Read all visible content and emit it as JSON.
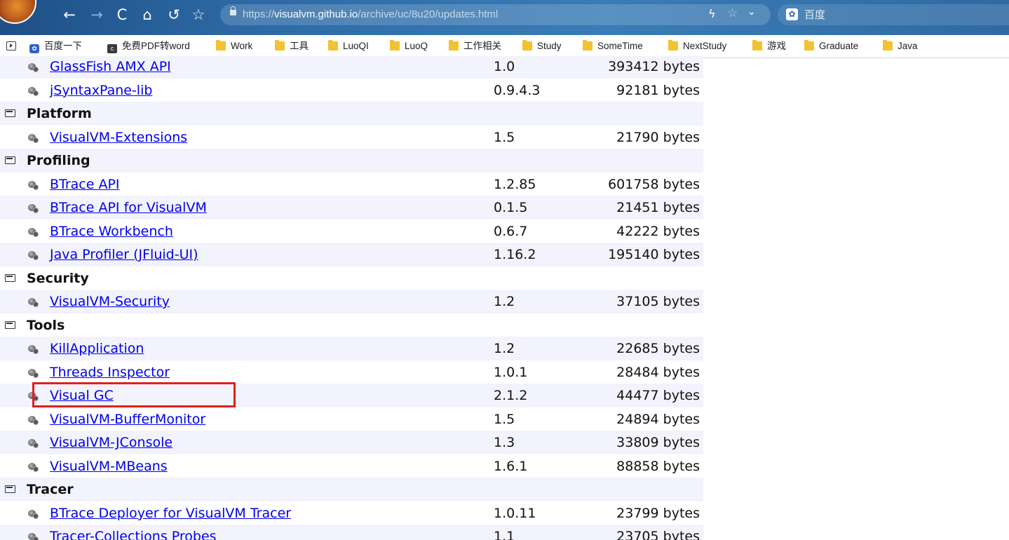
{
  "browser": {
    "nav_icons": {
      "back": "←",
      "forward": "→",
      "reload": "C",
      "home": "⌂",
      "undo": "↺",
      "star": "☆"
    },
    "url": {
      "scheme": "https://",
      "host": "visualvm.github.io",
      "path": "/archive/uc/8u20/updates.html"
    },
    "search_engine_label": "百度",
    "bookmarks": [
      {
        "label": "百度一下",
        "icon": "paw-icon"
      },
      {
        "label": "免费PDF转word",
        "icon": "c-icon"
      },
      {
        "label": "Work",
        "icon": "folder-icon"
      },
      {
        "label": "工具",
        "icon": "folder-icon"
      },
      {
        "label": "LuoQI",
        "icon": "folder-icon"
      },
      {
        "label": "LuoQ",
        "icon": "folder-icon"
      },
      {
        "label": "工作相关",
        "icon": "folder-icon"
      },
      {
        "label": "Study",
        "icon": "folder-icon"
      },
      {
        "label": "SomeTime",
        "icon": "folder-icon"
      },
      {
        "label": "NextStudy",
        "icon": "folder-icon"
      },
      {
        "label": "游戏",
        "icon": "folder-icon"
      },
      {
        "label": "Graduate",
        "icon": "folder-icon"
      },
      {
        "label": "Java",
        "icon": "folder-icon"
      }
    ]
  },
  "plugin_table": {
    "rows": [
      {
        "type": "plugin",
        "name": "GlassFish AMX API",
        "version": "1.0",
        "size": "393412 bytes"
      },
      {
        "type": "plugin",
        "name": "jSyntaxPane-lib",
        "version": "0.9.4.3",
        "size": "92181 bytes"
      },
      {
        "type": "category",
        "name": "Platform"
      },
      {
        "type": "plugin",
        "name": "VisualVM-Extensions",
        "version": "1.5",
        "size": "21790 bytes"
      },
      {
        "type": "category",
        "name": "Profiling"
      },
      {
        "type": "plugin",
        "name": "BTrace API",
        "version": "1.2.85",
        "size": "601758 bytes"
      },
      {
        "type": "plugin",
        "name": "BTrace API for VisualVM",
        "version": "0.1.5",
        "size": "21451 bytes"
      },
      {
        "type": "plugin",
        "name": "BTrace Workbench",
        "version": "0.6.7",
        "size": "42222 bytes"
      },
      {
        "type": "plugin",
        "name": "Java Profiler (JFluid-UI)",
        "version": "1.16.2",
        "size": "195140 bytes"
      },
      {
        "type": "category",
        "name": "Security"
      },
      {
        "type": "plugin",
        "name": "VisualVM-Security",
        "version": "1.2",
        "size": "37105 bytes"
      },
      {
        "type": "category",
        "name": "Tools"
      },
      {
        "type": "plugin",
        "name": "KillApplication",
        "version": "1.2",
        "size": "22685 bytes"
      },
      {
        "type": "plugin",
        "name": "Threads Inspector",
        "version": "1.0.1",
        "size": "28484 bytes"
      },
      {
        "type": "plugin",
        "name": "Visual GC",
        "version": "2.1.2",
        "size": "44477 bytes",
        "highlighted": true
      },
      {
        "type": "plugin",
        "name": "VisualVM-BufferMonitor",
        "version": "1.5",
        "size": "24894 bytes"
      },
      {
        "type": "plugin",
        "name": "VisualVM-JConsole",
        "version": "1.3",
        "size": "33809 bytes"
      },
      {
        "type": "plugin",
        "name": "VisualVM-MBeans",
        "version": "1.6.1",
        "size": "88858 bytes"
      },
      {
        "type": "category",
        "name": "Tracer"
      },
      {
        "type": "plugin",
        "name": "BTrace Deployer for VisualVM Tracer",
        "version": "1.0.11",
        "size": "23799 bytes"
      },
      {
        "type": "plugin",
        "name": "Tracer-Collections Probes",
        "version": "1.1",
        "size": "23705 bytes"
      }
    ]
  },
  "colors": {
    "link": "#0000ee",
    "row_alt_bg": "#f3f3fe",
    "highlight_border": "#e02020",
    "toolbar_bg": "#2d6aa5"
  }
}
